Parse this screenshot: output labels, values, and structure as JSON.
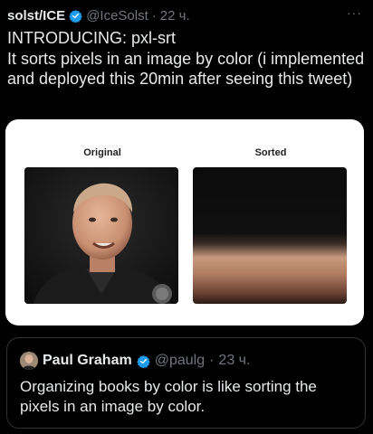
{
  "tweet": {
    "author_name": "solst/ICE",
    "handle": "@IceSolst",
    "separator": "·",
    "time": "22 ч.",
    "more": "···",
    "text": "INTRODUCING: pxl-srt\nIt sorts pixels in an image by color (i implemented and deployed this 20min after seeing this tweet)"
  },
  "media": {
    "label_original": "Original",
    "label_sorted": "Sorted"
  },
  "quote": {
    "author_name": "Paul Graham",
    "handle": "@paulg",
    "separator": "·",
    "time": "23 ч.",
    "text": "Organizing books by color is like sorting the pixels in an image by color."
  },
  "colors": {
    "verified": "#1d9bf0",
    "background": "#000000",
    "muted": "#71767b"
  }
}
